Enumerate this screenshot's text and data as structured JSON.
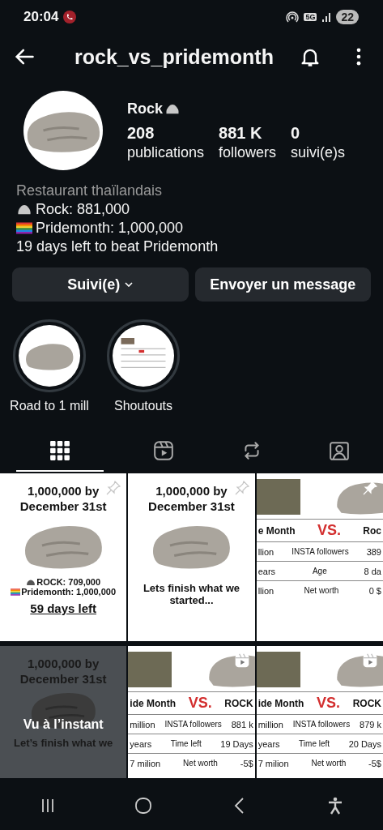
{
  "status_bar": {
    "time": "20:04",
    "network": "5G",
    "battery": "22"
  },
  "header": {
    "title": "rock_vs_pridemonth"
  },
  "profile": {
    "name": "Rock",
    "stats": [
      {
        "value": "208",
        "label": "publications"
      },
      {
        "value": "881 K",
        "label": "followers"
      },
      {
        "value": "0",
        "label": "suivi(e)s"
      }
    ],
    "category": "Restaurant thaïlandais",
    "bio": [
      {
        "kind": "rock",
        "text": "Rock: 881,000"
      },
      {
        "kind": "flag",
        "text": "Pridemonth: 1,000,000"
      },
      {
        "kind": "plain",
        "text": "19 days left to beat Pridemonth"
      }
    ]
  },
  "buttons": [
    {
      "label": "Suivi(e)",
      "dropdown": true
    },
    {
      "label": "Envoyer un message",
      "dropdown": false
    }
  ],
  "highlights": [
    {
      "label": "Road to 1 mill",
      "kind": "rock"
    },
    {
      "label": "Shoutouts",
      "kind": "table"
    }
  ],
  "tabs": [
    {
      "kind": "grid",
      "selected": true
    },
    {
      "kind": "reels",
      "selected": false
    },
    {
      "kind": "reposts",
      "selected": false
    },
    {
      "kind": "tagged",
      "selected": false
    }
  ],
  "posts": [
    {
      "kind": "rock",
      "pinned": true,
      "reel": false,
      "title": "1,000,000 by December 31st",
      "lines": [
        {
          "kind": "rock",
          "text": "ROCK: 709,000"
        },
        {
          "kind": "flag",
          "text": "Pridemonth: 1,000,000"
        }
      ],
      "footer": "59 days left",
      "underline": true
    },
    {
      "kind": "rock",
      "pinned": true,
      "reel": false,
      "title": "1,000,000 by December 31st",
      "footer": "Lets finish what we started...",
      "underline": false
    },
    {
      "kind": "table",
      "pinned": true,
      "reel": false,
      "head": [
        "e Month",
        "VS.",
        "Roc"
      ],
      "rows": [
        [
          "llion",
          "INSTA followers",
          "389"
        ],
        [
          "ears",
          "Age",
          "8 da"
        ],
        [
          "llion",
          "Net worth",
          "0 $"
        ]
      ]
    },
    {
      "kind": "rock",
      "pinned": false,
      "reel": false,
      "title": "1,000,000 by December 31st",
      "footer": "Let’s finish what we",
      "underline": false,
      "overlay": "Vu à l’instant"
    },
    {
      "kind": "table",
      "pinned": false,
      "reel": true,
      "head": [
        "ide Month",
        "VS.",
        "ROCK"
      ],
      "rows": [
        [
          "million",
          "INSTA followers",
          "881 k"
        ],
        [
          "years",
          "Time left",
          "19 Days"
        ],
        [
          "7 milion",
          "Net worth",
          "-5$"
        ]
      ]
    },
    {
      "kind": "table",
      "pinned": false,
      "reel": true,
      "head": [
        "ide Month",
        "VS.",
        "ROCK"
      ],
      "rows": [
        [
          "million",
          "INSTA followers",
          "879 k"
        ],
        [
          "years",
          "Time left",
          "20 Days"
        ],
        [
          "7 milion",
          "Net worth",
          "-5$"
        ]
      ]
    }
  ]
}
